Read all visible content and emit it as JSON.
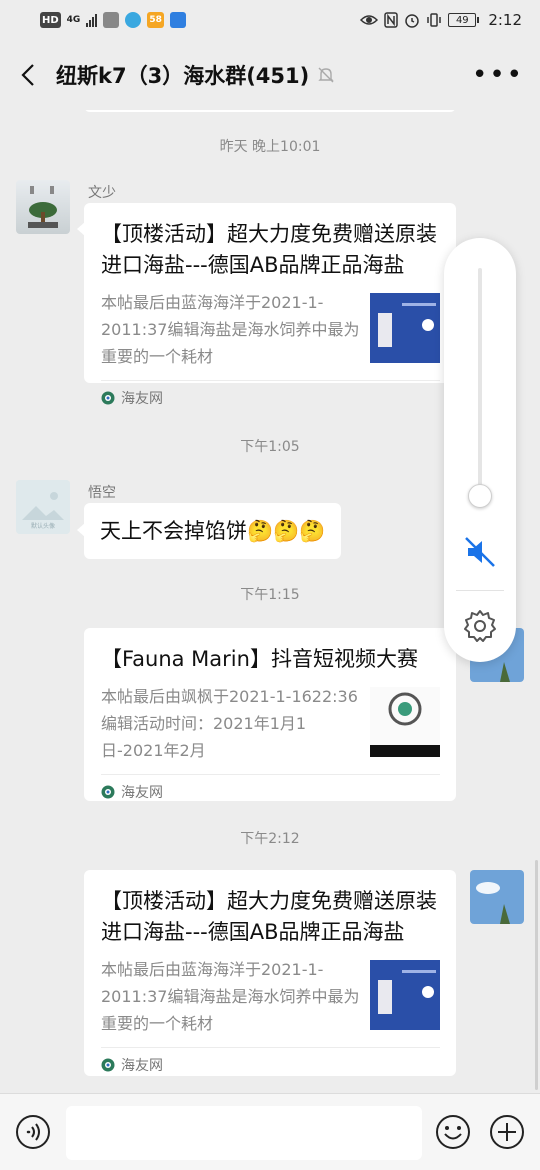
{
  "status_bar": {
    "hd": "HD",
    "net": "4G",
    "badge_app": "58",
    "battery": "49",
    "time": "2:12"
  },
  "header": {
    "title": "纽斯k7（3）海水群(451)"
  },
  "messages": {
    "ts1": "昨天 晚上10:01",
    "m1": {
      "sender": "文少",
      "title": "【顶楼活动】超大力度免费赠送原装进口海盐---德国AB品牌正品海盐",
      "desc": "本帖最后由蓝海海洋于2021-1-2011:37编辑海盐是海水饲养中最为重要的一个耗材",
      "source": "海友网"
    },
    "ts2": "下午1:05",
    "m2": {
      "sender": "悟空",
      "avatar_text": "默认头像",
      "text": "天上不会掉馅饼🤔🤔🤔"
    },
    "ts3": "下午1:15",
    "m3": {
      "title": "【Fauna Marin】抖音短视频大赛",
      "desc": "本帖最后由飒枫于2021-1-1622:36编辑活动时间：2021年1月1日-2021年2月",
      "source": "海友网"
    },
    "ts4": "下午2:12",
    "m4": {
      "title": "【顶楼活动】超大力度免费赠送原装进口海盐---德国AB品牌正品海盐",
      "desc": "本帖最后由蓝海海洋于2021-1-2011:37编辑海盐是海水饲养中最为重要的一个耗材",
      "source": "海友网"
    }
  },
  "volume": {
    "level": 0.05,
    "muted": true
  },
  "input": {
    "value": ""
  },
  "colors": {
    "bg": "#ededed",
    "accent_blue": "#1a73e8",
    "muted_text": "#8a8a8a"
  },
  "icons": [
    "back-icon",
    "mute-icon",
    "more-icon",
    "voice-icon",
    "emoji-icon",
    "plus-icon",
    "speaker-mute-icon",
    "settings-icon"
  ]
}
